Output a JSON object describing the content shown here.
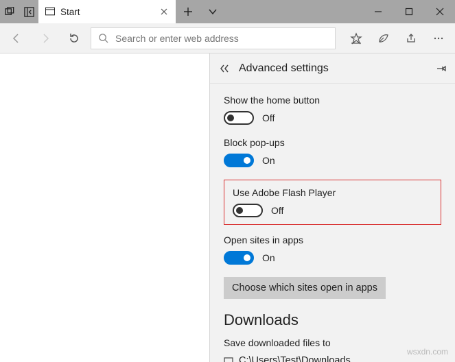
{
  "titlebar": {
    "tab_title": "Start"
  },
  "toolbar": {
    "search_placeholder": "Search or enter web address"
  },
  "pane": {
    "title": "Advanced settings"
  },
  "settings": {
    "home_button": {
      "label": "Show the home button",
      "state": "Off"
    },
    "popups": {
      "label": "Block pop-ups",
      "state": "On"
    },
    "flash": {
      "label": "Use Adobe Flash Player",
      "state": "Off"
    },
    "open_in_apps": {
      "label": "Open sites in apps",
      "state": "On"
    },
    "choose_sites_btn": "Choose which sites open in apps"
  },
  "downloads": {
    "heading": "Downloads",
    "save_label": "Save downloaded files to",
    "path": "C:\\Users\\Test\\Downloads"
  },
  "watermark": "wsxdn.com"
}
